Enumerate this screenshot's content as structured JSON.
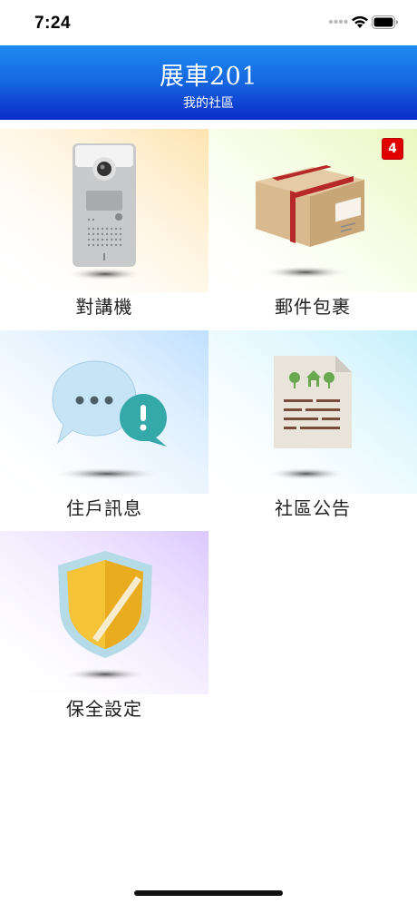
{
  "status_bar": {
    "time": "7:24"
  },
  "header": {
    "title": "展車201",
    "subtitle": "我的社區"
  },
  "tiles": [
    {
      "label": "對講機",
      "icon": "intercom-icon",
      "glow": "#fde8b8"
    },
    {
      "label": "郵件包裹",
      "icon": "package-icon",
      "glow": "#eef9c8",
      "badge": "4"
    },
    {
      "label": "住戶訊息",
      "icon": "chat-bubbles-icon",
      "glow": "#cfe8ff"
    },
    {
      "label": "社區公告",
      "icon": "notice-document-icon",
      "glow": "#cdf3fb"
    },
    {
      "label": "保全設定",
      "icon": "security-shield-icon",
      "glow": "#e6d8ff"
    }
  ],
  "colors": {
    "header_top": "#1e8cf0",
    "header_bottom": "#0b2bc8",
    "badge": "#e00000"
  }
}
